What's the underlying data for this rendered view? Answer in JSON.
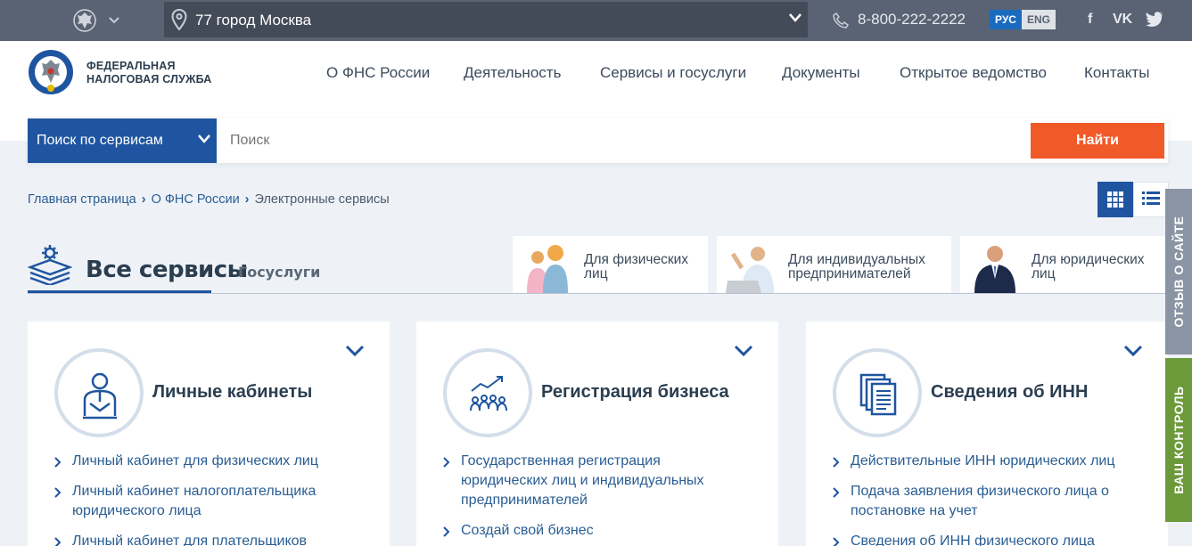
{
  "topbar": {
    "region": "77 город Москва",
    "phone": "8-800-222-2222",
    "lang_ru": "РУС",
    "lang_en": "ENG",
    "social": [
      "facebook-icon",
      "vk-icon",
      "twitter-icon"
    ],
    "social_glyphs": [
      "f",
      "VK",
      "🐦"
    ]
  },
  "header": {
    "logo_line1": "ФЕДЕРАЛЬНАЯ",
    "logo_line2": "НАЛОГОВАЯ СЛУЖБА",
    "nav": [
      "О ФНС России",
      "Деятельность",
      "Сервисы и госуслуги",
      "Документы",
      "Открытое ведомство",
      "Контакты"
    ]
  },
  "search": {
    "scope": "Поиск по сервисам",
    "placeholder": "Поиск",
    "button": "Найти"
  },
  "breadcrumb": [
    "Главная страница",
    "О ФНС России",
    "Электронные сервисы"
  ],
  "tabs": {
    "all": "Все сервисы",
    "gos": "Госуслуги"
  },
  "audiences": [
    {
      "label": "Для физических\nлиц"
    },
    {
      "label": "Для индивидуальных\nпредпринимателей"
    },
    {
      "label": "Для юридических\nлиц"
    }
  ],
  "cards": [
    {
      "title": "Личные кабинеты",
      "links": [
        "Личный кабинет для физических лиц",
        "Личный кабинет налогоплательщика юридического лица",
        "Личный кабинет для плательщиков"
      ]
    },
    {
      "title": "Регистрация бизнеса",
      "links": [
        "Государственная регистрация юридических лиц и индивидуальных предпринимателей",
        "Создай свой бизнес"
      ]
    },
    {
      "title": "Сведения об ИНН",
      "links": [
        "Действительные ИНН юридических лиц",
        "Подача заявления физического лица о постановке на учет",
        "Сведения об ИНН физического лица"
      ]
    }
  ],
  "side": {
    "feedback": "ОТЗЫВ О САЙТЕ",
    "control": "ВАШ КОНТРОЛЬ"
  },
  "colors": {
    "primary": "#1f55a0",
    "accent": "#f05a28",
    "topbar": "#5a6373",
    "feedback": "#8a94a3",
    "control": "#6c9a3a"
  }
}
